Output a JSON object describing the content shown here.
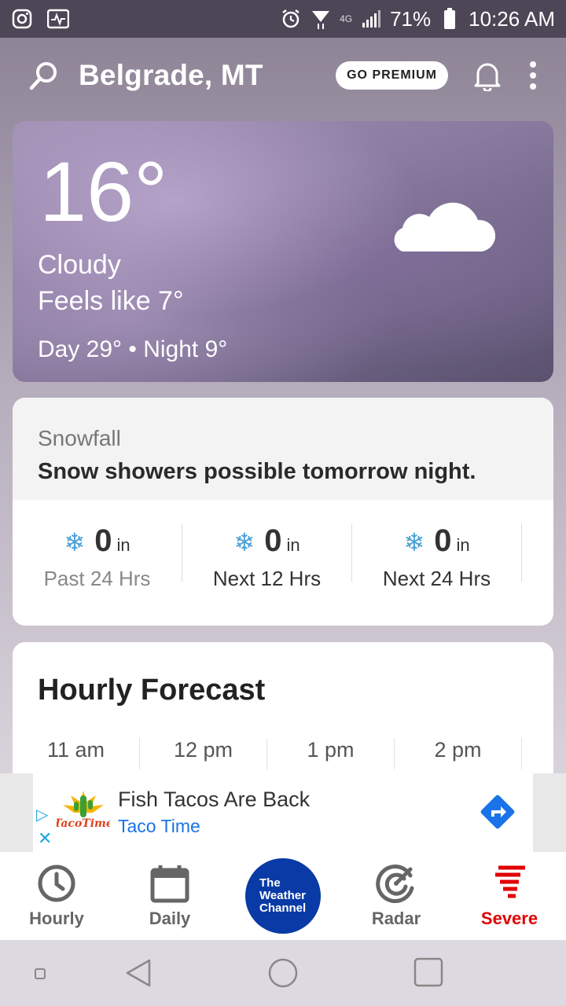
{
  "status_bar": {
    "battery": "71%",
    "time": "10:26 AM",
    "network": "4G"
  },
  "header": {
    "location": "Belgrade, MT",
    "premium_label": "GO PREMIUM"
  },
  "current": {
    "temperature": "16°",
    "condition": "Cloudy",
    "feels_like": "Feels like 7°",
    "day_night": "Day 29° • Night 9°"
  },
  "snowfall": {
    "title": "Snowfall",
    "description": "Snow showers possible tomorrow night.",
    "periods": [
      {
        "amount": "0",
        "unit": "in",
        "label": "Past 24 Hrs"
      },
      {
        "amount": "0",
        "unit": "in",
        "label": "Next 12 Hrs"
      },
      {
        "amount": "0",
        "unit": "in",
        "label": "Next 24 Hrs"
      }
    ]
  },
  "hourly": {
    "title": "Hourly Forecast",
    "hours": [
      "11 am",
      "12 pm",
      "1 pm",
      "2 pm"
    ]
  },
  "ad": {
    "title": "Fish Tacos Are Back",
    "advertiser": "Taco Time",
    "logo_text": "TacoTime"
  },
  "bottom_nav": {
    "hourly": "Hourly",
    "daily": "Daily",
    "brand_line1": "The",
    "brand_line2": "Weather",
    "brand_line3": "Channel",
    "radar": "Radar",
    "severe": "Severe"
  },
  "colors": {
    "brand_blue": "#0a3aa6",
    "severe_red": "#e10000",
    "snow_blue": "#4aa0d6"
  }
}
